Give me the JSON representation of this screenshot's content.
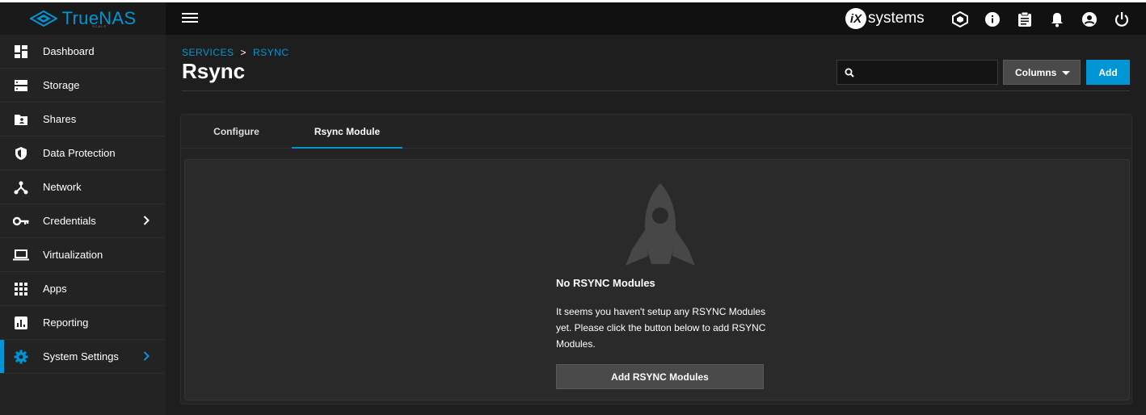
{
  "brand": {
    "name": "TrueNAS",
    "edition": "SCALE",
    "vendor": "systems",
    "accent": "#0095d5"
  },
  "topbar": {
    "icons": [
      "truecommand-icon",
      "info-icon",
      "clipboard-icon",
      "bell-icon",
      "account-icon",
      "power-icon"
    ]
  },
  "sidebar": {
    "items": [
      {
        "label": "Dashboard",
        "icon": "dashboard-icon"
      },
      {
        "label": "Storage",
        "icon": "storage-icon"
      },
      {
        "label": "Shares",
        "icon": "shares-icon"
      },
      {
        "label": "Data Protection",
        "icon": "shield-icon"
      },
      {
        "label": "Network",
        "icon": "network-icon"
      },
      {
        "label": "Credentials",
        "icon": "key-icon"
      },
      {
        "label": "Virtualization",
        "icon": "laptop-icon"
      },
      {
        "label": "Apps",
        "icon": "apps-grid-icon"
      },
      {
        "label": "Reporting",
        "icon": "reporting-icon"
      },
      {
        "label": "System Settings",
        "icon": "gear-icon"
      }
    ],
    "active": "System Settings"
  },
  "breadcrumb": {
    "parent": "SERVICES",
    "separator": ">",
    "current": "RSYNC"
  },
  "page": {
    "title": "Rsync"
  },
  "toolbar": {
    "search_placeholder": "",
    "columns_label": "Columns",
    "add_label": "Add"
  },
  "tabs": [
    {
      "label": "Configure"
    },
    {
      "label": "Rsync Module"
    }
  ],
  "active_tab": "Rsync Module",
  "empty_state": {
    "title": "No RSYNC Modules",
    "message": "It seems you haven't setup any RSYNC Modules yet. Please click the button below to add RSYNC Modules.",
    "button_label": "Add RSYNC Modules"
  }
}
